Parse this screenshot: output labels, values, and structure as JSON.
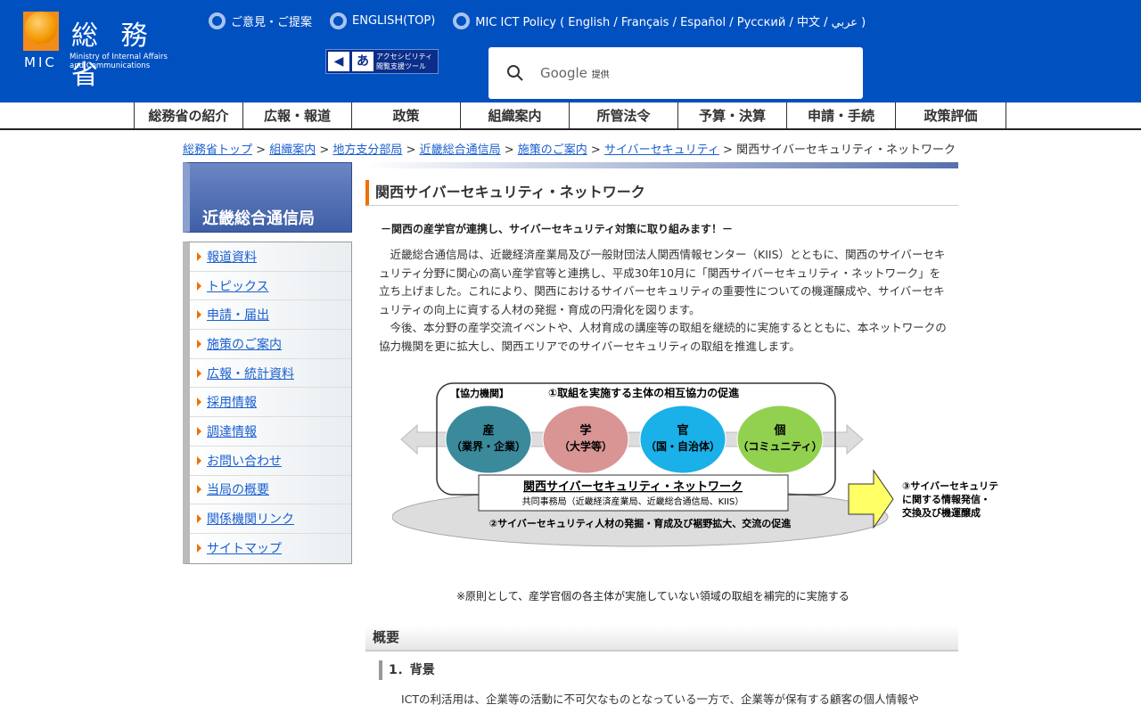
{
  "header": {
    "logo_kanji": "総 務 省",
    "logo_abbr": "MIC",
    "logo_en1": "Ministry of Internal Affairs",
    "logo_en2": "and Communications",
    "links": [
      "ご意見・ご提案",
      "ENGLISH(TOP)",
      "MIC ICT Policy ( English / Français / Español / Русский / 中文 / عربي )"
    ],
    "accessibility_label1": "アクセシビリティ",
    "accessibility_label2": "閲覧支援ツール",
    "search_brand": "Google",
    "search_provided": "提供"
  },
  "nav": [
    "総務省の紹介",
    "広報・報道",
    "政策",
    "組織案内",
    "所管法令",
    "予算・決算",
    "申請・手続",
    "政策評価"
  ],
  "breadcrumb": {
    "links": [
      "総務省トップ",
      "組織案内",
      "地方支分部局",
      "近畿総合通信局",
      "施策のご案内",
      "サイバーセキュリティ"
    ],
    "current": "関西サイバーセキュリティ・ネットワーク",
    "sep": " > "
  },
  "sidebar": {
    "title": "近畿総合通信局",
    "items": [
      "報道資料",
      "トピックス",
      "申請・届出",
      "施策のご案内",
      "広報・統計資料",
      "採用情報",
      "調達情報",
      "お問い合わせ",
      "当局の概要",
      "関係機関リンク",
      "サイトマップ"
    ]
  },
  "main": {
    "title": "関西サイバーセキュリティ・ネットワーク",
    "lead": "－関西の産学官が連携し、サイバーセキュリティ対策に取り組みます！－",
    "paragraphs": [
      "近畿総合通信局は、近畿経済産業局及び一般財団法人関西情報センター（KIIS）とともに、関西のサイバーセキュリティ分野に関心の高い産学官等と連携し、平成30年10月に「関西サイバーセキュリティ・ネットワーク」を立ち上げました。これにより、関西におけるサイバーセキュリティの重要性についての機運醸成や、サイバーセキュリティの向上に資する人材の発掘・育成の円滑化を図ります。",
      "今後、本分野の産学交流イベントや、人材育成の講座等の取組を継続的に実施するとともに、本ネットワークの協力機関を更に拡大し、関西エリアでのサイバーセキュリティの取組を推進します。"
    ],
    "diagram": {
      "partners_label": "【協力機関】",
      "point1": "①取組を実施する主体の相互協力の促進",
      "circles": [
        {
          "l1": "産",
          "l2": "（業界・企業）",
          "color": "#3a8a9c"
        },
        {
          "l1": "学",
          "l2": "（大学等）",
          "color": "#d99594"
        },
        {
          "l1": "官",
          "l2": "（国・自治体）",
          "color": "#1ab0e8"
        },
        {
          "l1": "個",
          "l2": "（コミュニティ）",
          "color": "#92d050"
        }
      ],
      "network_name": "関西サイバーセキュリティ・ネットワーク",
      "secretariat": "共同事務局（近畿経済産業局、近畿総合通信局、KIIS）",
      "point2": "②サイバーセキュリティ人材の発掘・育成及び裾野拡大、交流の促進",
      "point3_l1": "③サイバーセキュリティ",
      "point3_l2": "に関する情報発信・",
      "point3_l3": "交換及び機運醸成"
    },
    "note": "※原則として、産学官個の各主体が実施していない領域の取組を補完的に実施する",
    "section_title": "概要",
    "subsection_title": "1．背景",
    "background_text": "ICTの利活用は、企業等の活動に不可欠なものとなっている一方で、企業等が保有する顧客の個人情報や"
  }
}
